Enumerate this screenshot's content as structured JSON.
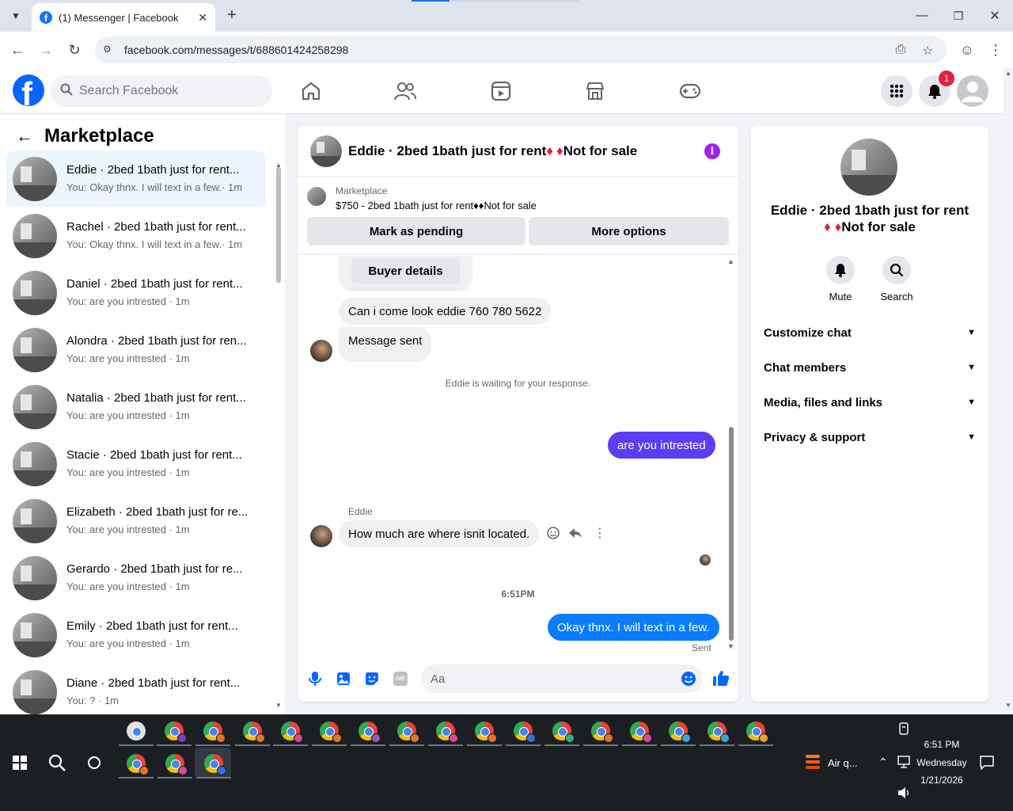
{
  "browser": {
    "tab_title": "(1) Messenger | Facebook",
    "url": "facebook.com/messages/t/688601424258298"
  },
  "fb_header": {
    "logo_letter": "f",
    "search_placeholder": "Search Facebook",
    "notification_count": "1"
  },
  "left_panel": {
    "title": "Marketplace",
    "conversations": [
      {
        "name": "Eddie · 2bed 1bath just for rent...",
        "preview": "You: Okay thnx. I will text in a few.· 1m",
        "active": true
      },
      {
        "name": "Rachel · 2bed 1bath just for rent...",
        "preview": "You: Okay thnx. I will text in a few.· 1m",
        "active": false
      },
      {
        "name": "Daniel · 2bed 1bath just for rent...",
        "preview": "You: are you intrested · 1m",
        "active": false
      },
      {
        "name": "Alondra · 2bed 1bath just for ren...",
        "preview": "You: are you intrested · 1m",
        "active": false
      },
      {
        "name": "Natalia · 2bed 1bath just for rent...",
        "preview": "You: are you intrested · 1m",
        "active": false
      },
      {
        "name": "Stacie · 2bed 1bath just for rent...",
        "preview": "You: are you intrested · 1m",
        "active": false
      },
      {
        "name": "Elizabeth · 2bed 1bath just for re...",
        "preview": "You: are you intrested · 1m",
        "active": false
      },
      {
        "name": "Gerardo · 2bed 1bath just for re...",
        "preview": "You: are you intrested · 1m",
        "active": false
      },
      {
        "name": "Emily · 2bed 1bath just for rent...",
        "preview": "You: are you intrested · 1m",
        "active": false
      },
      {
        "name": "Diane · 2bed 1bath just for rent...",
        "preview": "You: ? · 1m",
        "active": false
      }
    ]
  },
  "chat": {
    "title_prefix": "Eddie · 2bed 1bath just for rent",
    "title_suffix": "Not for sale",
    "diamond": "♦",
    "listing_source": "Marketplace",
    "listing_text": "$750 - 2bed 1bath just for rent♦♦Not for sale",
    "mark_pending": "Mark as pending",
    "more_options": "More options",
    "buyer_details": "Buyer details",
    "msg_1": "Can i come look eddie 760 780 5622",
    "msg_2": "Message sent",
    "waiting": "Eddie is waiting for your response.",
    "msg_3": "are you  intrested",
    "sender_name": "Eddie",
    "msg_4": "How much are where isnit located.",
    "time": "6:51PM",
    "msg_5": "Okay thnx. I will text in a few.",
    "sent_status": "Sent",
    "input_placeholder": "Aa",
    "gif_label": "GIF",
    "colors": {
      "purple": "#5b3df5",
      "blue": "#0a7cff"
    }
  },
  "right_panel": {
    "name_line1": "Eddie · 2bed 1bath just for rent",
    "name_line2": "Not for sale",
    "mute": "Mute",
    "search": "Search",
    "sections": [
      "Customize chat",
      "Chat members",
      "Media, files and links",
      "Privacy & support"
    ]
  },
  "taskbar": {
    "weather": "Air q...",
    "time": "6:51 PM",
    "day": "Wednesday",
    "date": "1/21/2026"
  }
}
